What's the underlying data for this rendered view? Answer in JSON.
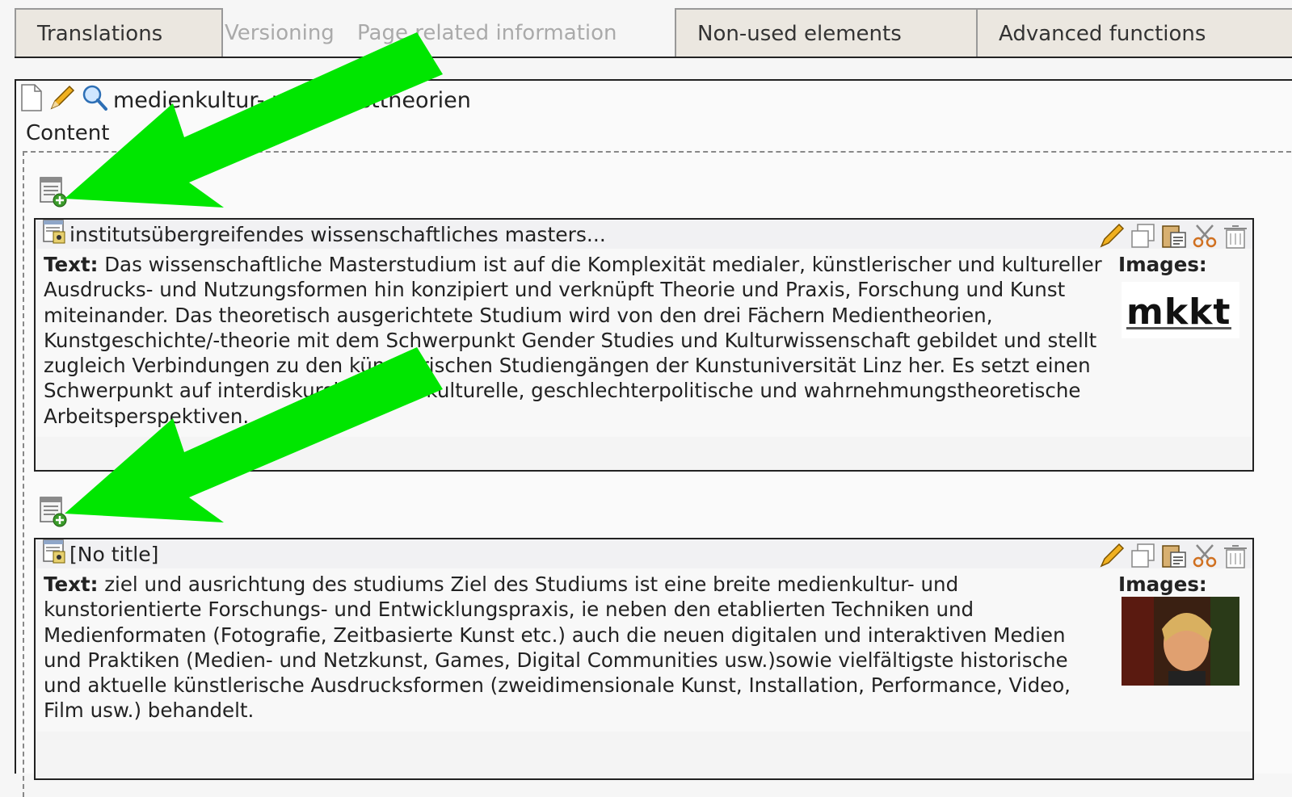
{
  "tabs": [
    {
      "label": "Translations",
      "style": "tab"
    },
    {
      "label": "Versioning",
      "style": "plain"
    },
    {
      "label": "Page related information",
      "style": "plain"
    },
    {
      "label": "Non-used elements",
      "style": "tab"
    },
    {
      "label": "Advanced functions",
      "style": "tab"
    }
  ],
  "page": {
    "title": "medienkultur- und kunsttheorien",
    "content_label": "Content"
  },
  "records": [
    {
      "title": "institutsübergreifendes wissenschaftliches masters...",
      "text_label": "Text:",
      "text": "Das wissenschaftliche Masterstudium ist auf die Komplexität medialer, künstlerischer und kultureller Ausdrucks- und Nutzungsformen hin konzipiert und verknüpft Theorie und Praxis, Forschung und Kunst miteinander. Das theoretisch ausgerichtete Studium wird von den drei Fächern Medientheorien, Kunstgeschichte/-theorie mit dem Schwerpunkt Gender Studies und Kulturwissenschaft gebildet und stellt zugleich Verbindungen zu den künstlerischen Studiengängen der Kunstuniversität Linz her. Es setzt einen Schwerpunkt auf interdiskursive, transkulturelle, geschlechterpolitische und wahrnehmungstheoretische Arbeitsperspektiven.",
      "images_label": "Images:",
      "image_text": "mkkt"
    },
    {
      "title": "[No title]",
      "text_label": "Text:",
      "text": "ziel und ausrichtung des studiums Ziel des Studiums ist eine breite medienkultur- und kunstorientierte Forschungs- und Entwicklungspraxis, ie neben den etablierten Techniken und Medienformaten (Fotografie, Zeitbasierte Kunst etc.) auch die neuen digitalen und interaktiven Medien und Praktiken (Medien- und Netzkunst, Games, Digital Communities usw.)sowie vielfältigste historische und aktuelle künstlerische Ausdrucksformen (zweidimensionale Kunst, Installation, Performance, Video, Film usw.) behandelt.",
      "images_label": "Images:"
    }
  ],
  "colors": {
    "annotation_arrow": "#00e600",
    "tab_bg": "#ebe7e0",
    "panel_border": "#222222"
  },
  "icons": [
    "page-icon",
    "pencil-icon",
    "magnifier-icon",
    "new-record-icon",
    "record-icon",
    "edit-icon",
    "copy-icon",
    "paste-icon",
    "cut-icon",
    "trash-icon"
  ]
}
